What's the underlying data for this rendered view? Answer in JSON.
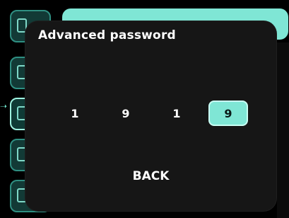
{
  "dialog": {
    "title": "Advanced password",
    "digits": [
      "1",
      "9",
      "1",
      "9"
    ],
    "selected_index": 3,
    "back_label": "BACK"
  },
  "colors": {
    "accent": "#7fe6d5",
    "dialog_bg": "#161616",
    "page_bg": "#000000",
    "text": "#ffffff"
  }
}
